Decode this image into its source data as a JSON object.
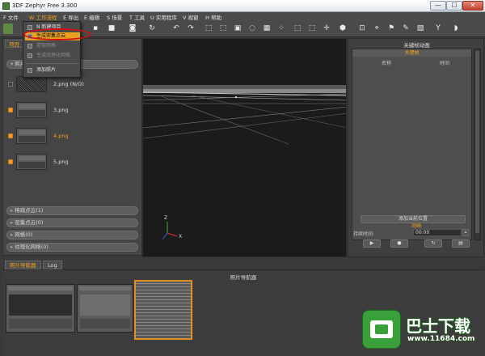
{
  "window": {
    "title": "3DF Zephyr Free 3.300",
    "min": "—",
    "max": "☐",
    "close": "✕"
  },
  "menu": [
    "F 文件",
    "W 工作流程",
    "E 导出",
    "E 编辑",
    "S 场景",
    "T 工具",
    "U 实用程序",
    "V 视窗",
    "H 帮助"
  ],
  "dropdown": {
    "items": [
      {
        "label": "N 新建项目",
        "state": "normal"
      },
      {
        "label": "生成密集点云",
        "state": "highlight"
      },
      {
        "label": "提取网格",
        "state": "disabled"
      },
      {
        "label": "生成纹理化网格",
        "state": "disabled"
      },
      {
        "label": "添加照片",
        "state": "normal"
      }
    ]
  },
  "left_panel": {
    "tabs": [
      "项目"
    ],
    "images_section": "照片",
    "images": [
      {
        "name": "2.png (N/O)",
        "checked": false,
        "noisy": true,
        "selected": false
      },
      {
        "name": "3.png",
        "checked": true,
        "noisy": false,
        "selected": false
      },
      {
        "name": "4.png",
        "checked": true,
        "noisy": false,
        "selected": true
      },
      {
        "name": "5.png",
        "checked": true,
        "noisy": false,
        "selected": false
      }
    ],
    "sections": [
      "稀疏点云(1)",
      "密集点云(0)",
      "网格(0)",
      "纹理化网格(0)"
    ]
  },
  "viewport": {
    "axis_z": "Z",
    "axis_x": "X"
  },
  "right_panel": {
    "title": "关键帧动画",
    "keyframes_header": "关键帧",
    "col_name": "名称",
    "col_time": "时间",
    "add_button": "添加当前位置",
    "animation_header": "动画",
    "duration_label": "持续时间:",
    "duration_value": "00:00",
    "controls": [
      "▶",
      "●",
      "↻",
      "▤"
    ]
  },
  "bottom": {
    "tabs": [
      "照片导航器",
      "Log"
    ],
    "navigator_title": "照片导航器"
  },
  "watermark": {
    "name": "巴士下载",
    "url": "www.11684.com"
  },
  "colors": {
    "accent": "#f0a020",
    "highlight_oval": "#d21010",
    "background": "#3a3a3a",
    "viewport": "#1b1b1b"
  }
}
